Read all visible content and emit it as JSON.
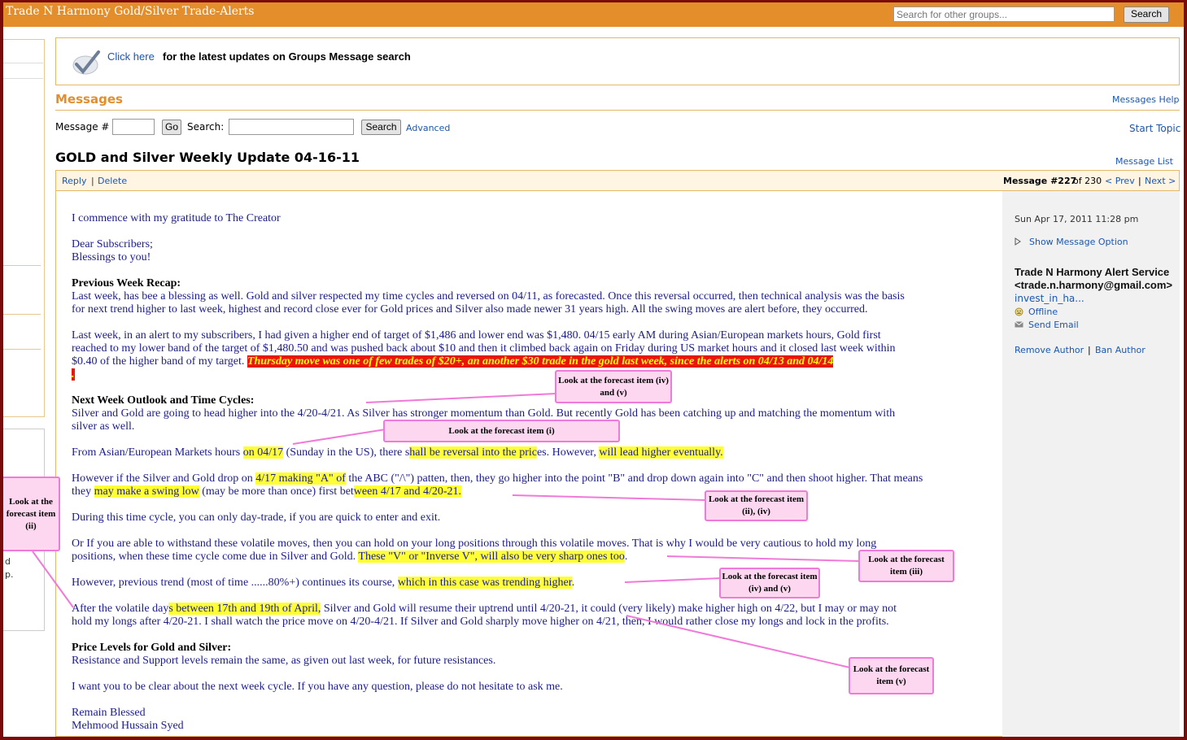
{
  "header": {
    "group_title": "Trade N Harmony Gold/Silver Trade-Alerts",
    "search_placeholder": "Search for other groups...",
    "search_button": "Search"
  },
  "notice": {
    "link": "Click here",
    "text": "for the latest updates on Groups Message search"
  },
  "messages": {
    "title": "Messages",
    "help": "Messages Help",
    "msgno_label": "Message #",
    "go": "Go",
    "search_label": "Search:",
    "search_button": "Search",
    "advanced": "Advanced",
    "start_topic": "Start Topic",
    "message_list": "Message List"
  },
  "message": {
    "subject": "GOLD and Silver Weekly Update 04-16-11",
    "reply": "Reply",
    "delete": "Delete",
    "sep": "|",
    "number": "Message #227",
    "of": "of 230",
    "prev": "< Prev",
    "next": "Next >",
    "date": "Sun Apr 17, 2011 11:28 pm",
    "show_option": "Show Message Option",
    "author_name": "Trade N Harmony Alert Service",
    "author_email": "<trade.n.harmony@gmail.com>",
    "author_id": "invest_in_ha...",
    "status": "Offline",
    "send_email": "Send Email",
    "remove_author": "Remove Author",
    "ban_author": "Ban Author"
  },
  "sidebar": {
    "fragment_1": "d",
    "fragment_2": "p."
  },
  "body": {
    "gratitude": "I commence with my gratitude to The Creator",
    "greeting": "Dear Subscribers;",
    "blessing": "Blessings to you!",
    "recap_heading": "Previous Week Recap:",
    "recap_1": "Last week, has bee a blessing as well. Gold and silver respected my time cycles and reversed on 04/11, as forecasted. Once this reversal occurred, then technical analysis was the basis",
    "recap_2": "for next trend higher to last week, highest and record close ever for Gold prices and Silver also made newer 31 years high. All the swing moves are alert before, they occurred.",
    "target_1": "Last week, in an alert to my subscribers, I had given a higher end of target of $1,486 and lower end was $1,480. 04/15 early AM during Asian/European markets hours, Gold first",
    "target_2": "reached to my lower band of the target of $1,480.50 and was pushed back about $10 and then it climbed back again on Friday during US market hours and it closed last week within",
    "target_3a": "$0.40 of the higher band of my target.",
    "target_3b": "Thursday move was one of few trades of $20+, an another $30 trade in the gold last week, since the alerts on 04/13 and 04/14",
    "target_4": ".",
    "outlook_heading": "Next Week Outlook and Time Cycles:",
    "outlook_1": "Silver and Gold are going to head higher into the 4/20-4/21. As Silver has stronger momentum than Gold. But recently Gold has been catching up and matching the momentum with",
    "outlook_2": "silver as well.",
    "asian_a": "From Asian/European Markets hours ",
    "asian_b": "on 04/17",
    "asian_c": " (Sunday in the US), there s",
    "asian_d": "hall be reversal into the pric",
    "asian_e": "es. However, ",
    "asian_f": "will lead higher eventually.",
    "drop_1a": "However if the Silver and Gold drop on ",
    "drop_1b": "4/17 making \"A\" of",
    "drop_1c": " the ABC (\"/\\\") patten, then, they go higher into the point \"B\" and drop down again into \"C\" and then shoot higher. That means",
    "drop_2a": "they ",
    "drop_2b": "may make a swing low",
    "drop_2c": " (may be more than once) first bet",
    "drop_2d": "ween 4/17 and 4/20-21.",
    "daytrade": "During this time cycle, you can only day-trade, if you are quick to enter and exit.",
    "withstand_1": "Or If you are able to withstand these volatile moves, then you can hold on your long positions through this volatile moves. That is why I would be very cautious to hold my long",
    "withstand_2a": "positions, when these time cycle come due in Silver and Gold. ",
    "withstand_2b": "These \"V\" or \"Inverse V\", will also be very sharp ones too",
    "withstand_2c": ".",
    "previous_a": "However, previous trend (most of time ......80%+) continues its course, ",
    "previous_b": "which in this case was trending higher",
    "previous_c": ".",
    "after_1a": "After the volatile day",
    "after_1b": "s between 17th and 19th  of April,",
    "after_1c": " Silver and Gold will resume their uptrend until 4/20-21, it could (very likely) make higher high on 4/22, but I may or may not",
    "after_2": "hold my longs after 4/20-21. I shall watch the price move on 4/20-4/21. If Silver and Gold sharply move higher on 4/21, then, I would rather close my longs and lock in the profits.",
    "levels_heading": "Price Levels for Gold and Silver:",
    "levels_1": "Resistance and Support levels remain the same, as given out last week, for future resistances.",
    "clear": "I want you to be clear about the next week cycle. If you have any question, please do not hesitate to ask me.",
    "remain": "Remain Blessed",
    "signature": "Mehmood Hussain Syed"
  },
  "callouts": {
    "c1": "Look at the forecast item (iv) and (v)",
    "c2": "Look at the forecast item (i)",
    "c3": "Look at the forecast item (ii), (iv)",
    "c4": "Look at the forecast item (iii)",
    "c5": "Look at the forecast item (iv) and (v)",
    "c6": "Look at the forecast item (v)",
    "c7": "Look at the forecast item (ii)"
  }
}
